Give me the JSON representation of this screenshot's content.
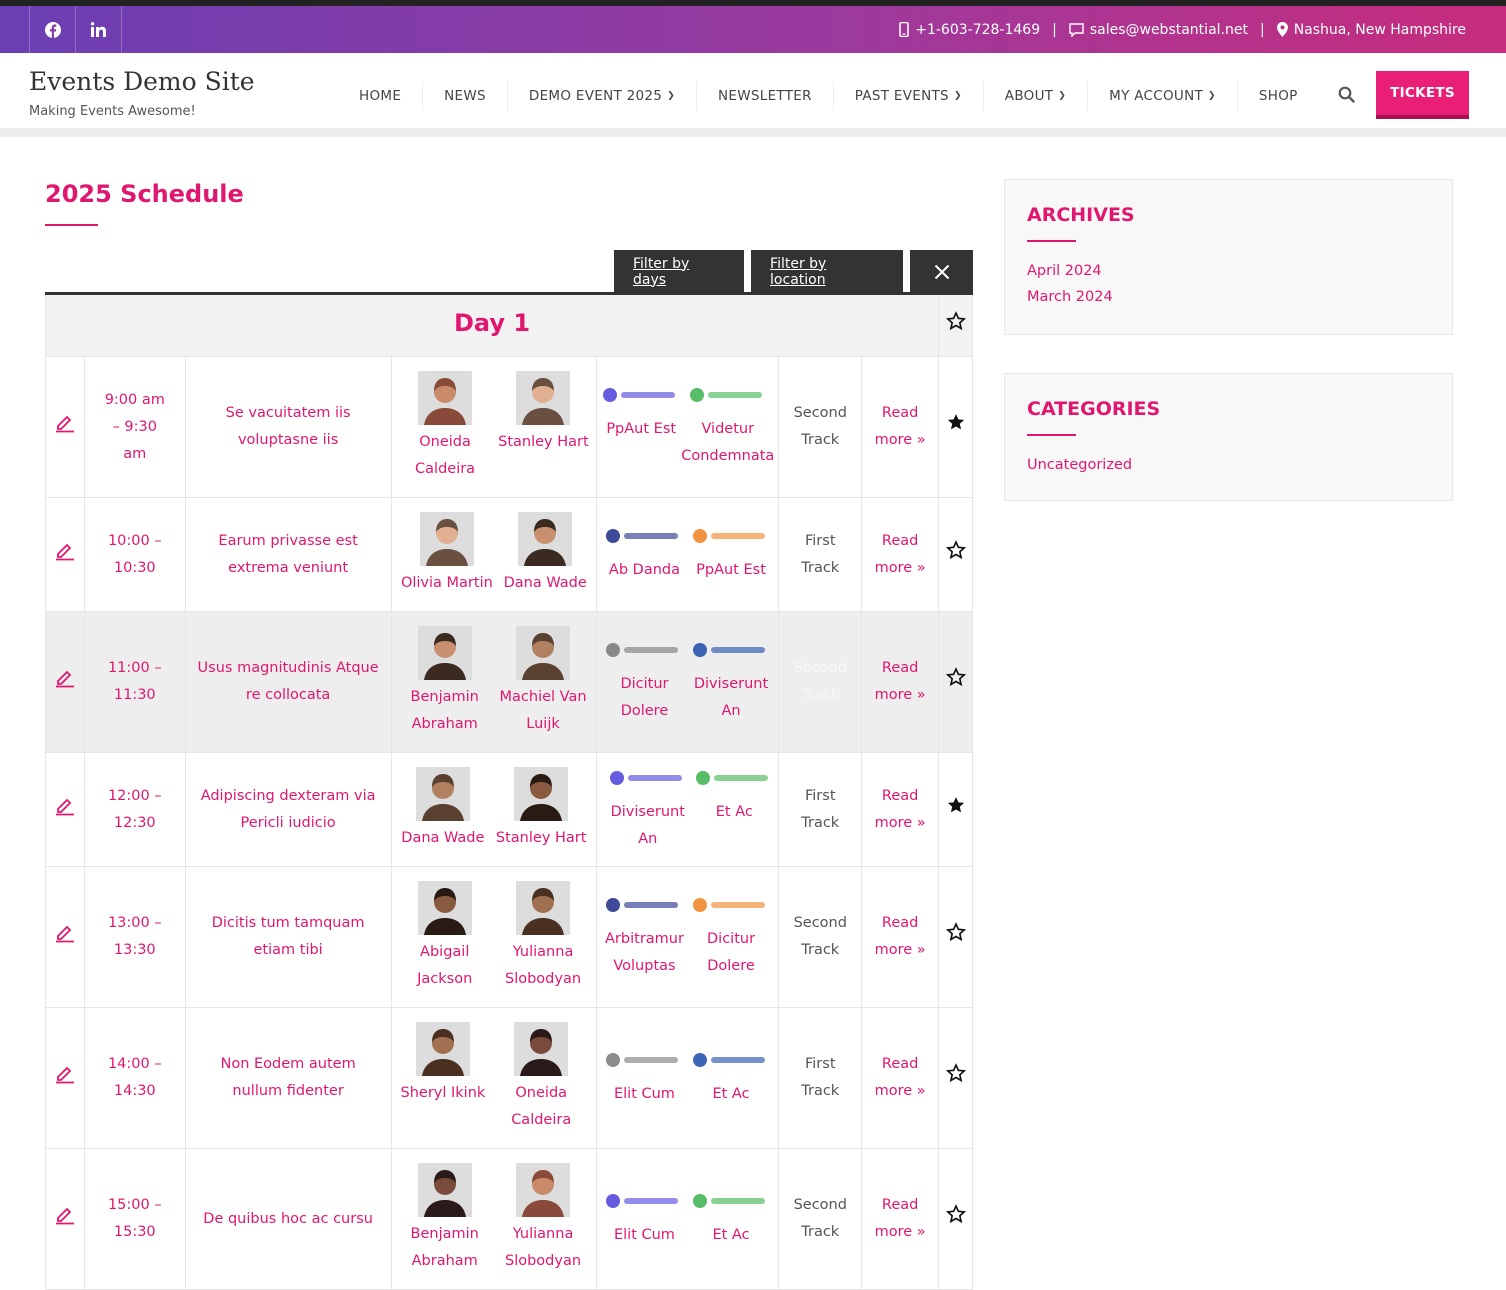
{
  "topbar": {
    "phone": "+1-603-728-1469",
    "email": "sales@webstantial.net",
    "location": "Nashua, New Hampshire",
    "gradient_colors": [
      "#6a3fb3",
      "#c72c7c"
    ]
  },
  "site": {
    "title": "Events Demo Site",
    "tagline": "Making Events Awesome!"
  },
  "nav": {
    "items": [
      {
        "label": "HOME",
        "dropdown": false
      },
      {
        "label": "NEWS",
        "dropdown": false
      },
      {
        "label": "DEMO EVENT 2025",
        "dropdown": true
      },
      {
        "label": "NEWSLETTER",
        "dropdown": false
      },
      {
        "label": "PAST EVENTS",
        "dropdown": true
      },
      {
        "label": "ABOUT",
        "dropdown": true
      },
      {
        "label": "MY ACCOUNT",
        "dropdown": true
      },
      {
        "label": "SHOP",
        "dropdown": false
      }
    ],
    "tickets_label": "TICKETS"
  },
  "page": {
    "title": "2025 Schedule"
  },
  "filters": {
    "days_label": "Filter by days",
    "location_label": "Filter by location"
  },
  "schedule": {
    "day_title": "Day 1",
    "sessions": [
      {
        "time": "9:00 am – 9:30 am",
        "title": "Se vacuitatem iis voluptasne iis",
        "speakers": [
          "Oneida Caldeira",
          "Stanley Hart"
        ],
        "sponsors": [
          "PpAut Est",
          "Videtur Condemnata"
        ],
        "track": "Second Track",
        "read_more": "Read more »",
        "starred": true
      },
      {
        "time": "10:00 – 10:30",
        "title": "Earum privasse est extrema veniunt",
        "speakers": [
          "Olivia Martin",
          "Dana Wade"
        ],
        "sponsors": [
          "Ab Danda",
          "PpAut Est"
        ],
        "track": "First Track",
        "read_more": "Read more »",
        "starred": false
      },
      {
        "time": "11:00 – 11:30",
        "title": "Usus magnitudinis Atque re collocata",
        "speakers": [
          "Benjamin Abraham",
          "Machiel Van Luijk"
        ],
        "sponsors": [
          "Dicitur Dolere",
          "Diviserunt An"
        ],
        "track": "Second Track",
        "read_more": "Read more »",
        "starred": false
      },
      {
        "time": "12:00 – 12:30",
        "title": "Adipiscing dexteram via Pericli iudicio",
        "speakers": [
          "Dana Wade",
          "Stanley Hart"
        ],
        "sponsors": [
          "Diviserunt An",
          "Et Ac"
        ],
        "track": "First Track",
        "read_more": "Read more »",
        "starred": true
      },
      {
        "time": "13:00 – 13:30",
        "title": "Dicitis tum tamquam etiam tibi",
        "speakers": [
          "Abigail Jackson",
          "Yulianna Slobodyan"
        ],
        "sponsors": [
          "Arbitramur Voluptas",
          "Dicitur Dolere"
        ],
        "track": "Second Track",
        "read_more": "Read more »",
        "starred": false
      },
      {
        "time": "14:00 – 14:30",
        "title": "Non Eodem autem nullum fidenter",
        "speakers": [
          "Sheryl Ikink",
          "Oneida Caldeira"
        ],
        "sponsors": [
          "Elit Cum",
          "Et Ac"
        ],
        "track": "First Track",
        "read_more": "Read more »",
        "starred": false
      },
      {
        "time": "15:00 – 15:30",
        "title": "De quibus hoc ac cursu",
        "speakers": [
          "Benjamin Abraham",
          "Yulianna Slobodyan"
        ],
        "sponsors": [
          "Elit Cum",
          "Et Ac"
        ],
        "track": "Second Track",
        "read_more": "Read more »",
        "starred": false
      }
    ]
  },
  "sidebar": {
    "archives": {
      "title": "ARCHIVES",
      "links": [
        "April 2024",
        "March 2024"
      ]
    },
    "categories": {
      "title": "CATEGORIES",
      "links": [
        "Uncategorized"
      ]
    }
  },
  "colors": {
    "accent": "#e0176f",
    "tickets": "#e91e75",
    "dark": "#333333"
  }
}
